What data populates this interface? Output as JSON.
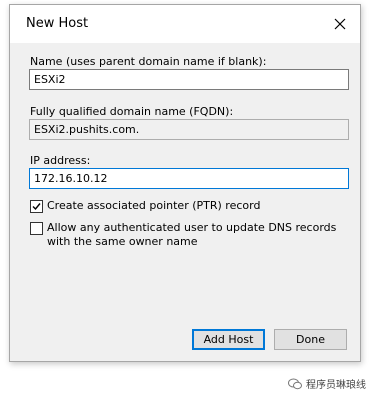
{
  "window": {
    "title": "New Host",
    "close_icon": "close-icon"
  },
  "name_field": {
    "label": "Name (uses parent domain name if blank):",
    "value": "ESXi2"
  },
  "fqdn_field": {
    "label": "Fully qualified domain name (FQDN):",
    "value": "ESXi2.pushits.com."
  },
  "ip_field": {
    "label": "IP address:",
    "value": "172.16.10.12"
  },
  "options": {
    "ptr_label": "Create associated pointer (PTR) record",
    "ptr_checked": true,
    "allow_update_label": "Allow any authenticated user to update DNS records with the same owner name",
    "allow_update_checked": false
  },
  "buttons": {
    "add_host": "Add Host",
    "done": "Done"
  },
  "watermark": {
    "text": "程序员琳琅线",
    "icon": "wechat-icon"
  },
  "colors": {
    "accent": "#0078d7",
    "dialog_bg": "#f0f0f0",
    "titlebar_bg": "#ffffff"
  }
}
